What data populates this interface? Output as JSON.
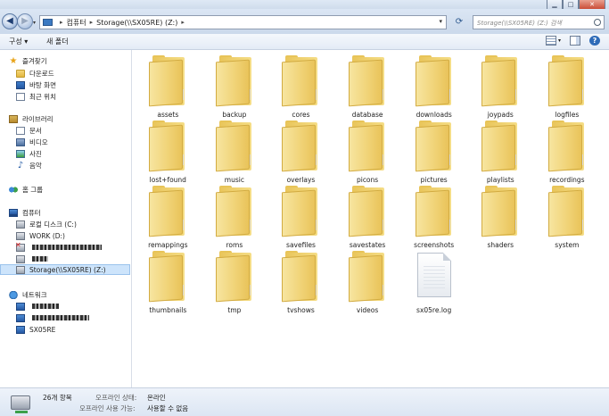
{
  "window": {
    "min_label": "▁",
    "max_label": "□",
    "close_label": "✕"
  },
  "address": {
    "crumbs": [
      "컴퓨터",
      "Storage(\\\\SX05RE) (Z:)"
    ],
    "search_placeholder": "Storage(\\\\SX05RE) (Z:) 검색"
  },
  "toolbar": {
    "organize_label": "구성 ▾",
    "new_folder_label": "새 폴더"
  },
  "nav": {
    "favorites": {
      "label": "즐겨찾기",
      "items": [
        "다운로드",
        "바탕 화면",
        "최근 위치"
      ]
    },
    "libraries": {
      "label": "라이브러리",
      "items": [
        "문서",
        "비디오",
        "사진",
        "음악"
      ]
    },
    "homegroup": {
      "label": "홈 그룹"
    },
    "computer": {
      "label": "컴퓨터",
      "items": [
        "로컬 디스크 (C:)",
        "WORK (D:)",
        "",
        "",
        "Storage(\\\\SX05RE) (Z:)"
      ]
    },
    "network": {
      "label": "네트워크",
      "items": [
        "",
        "",
        "SX05RE"
      ]
    }
  },
  "content": {
    "folders": [
      "assets",
      "backup",
      "cores",
      "database",
      "downloads",
      "joypads",
      "logfiles",
      "lost+found",
      "music",
      "overlays",
      "picons",
      "pictures",
      "playlists",
      "recordings",
      "remappings",
      "roms",
      "savefiles",
      "savestates",
      "screenshots",
      "shaders",
      "system",
      "thumbnails",
      "tmp",
      "tvshows",
      "videos"
    ],
    "files": [
      "sx05re.log"
    ]
  },
  "status": {
    "count": "26개 항목",
    "offline_status_label": "오프라인 상태:",
    "offline_status_value": "온라인",
    "offline_avail_label": "오프라인 사용 가능:",
    "offline_avail_value": "사용할 수 없음"
  },
  "icons": {
    "back": "arrow-left-icon",
    "forward": "arrow-right-icon",
    "refresh": "refresh-icon",
    "search": "search-icon",
    "help": "help-icon"
  }
}
